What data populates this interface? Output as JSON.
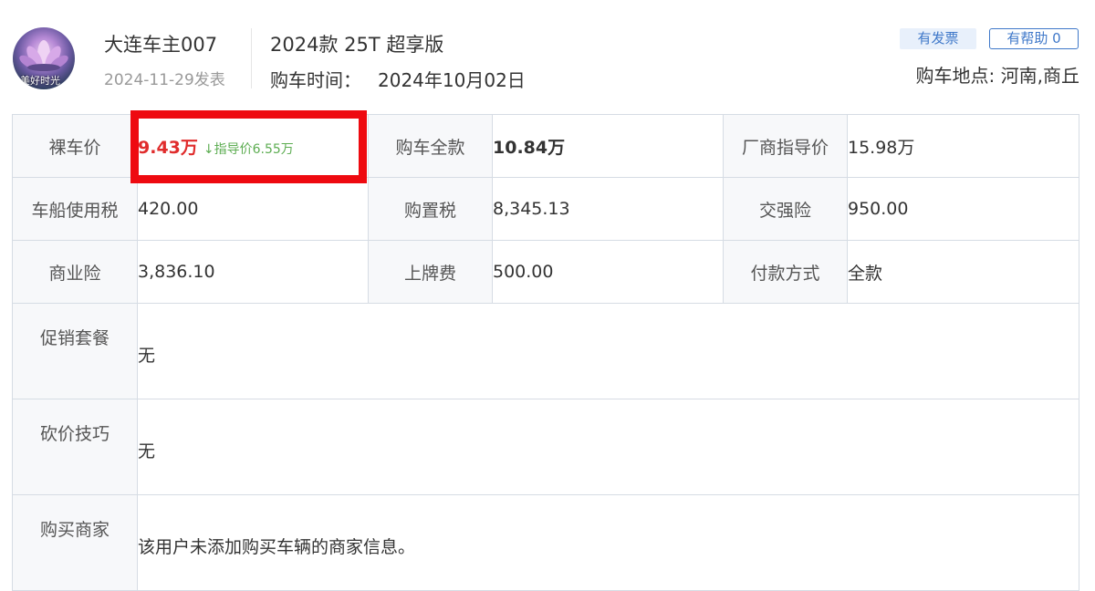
{
  "user": {
    "avatar_icon": "lotus-avatar-icon",
    "avatar_caption": "美好时光",
    "name": "大连车主007",
    "post_date": "2024-11-29发表"
  },
  "car": {
    "model": "2024款 25T 超享版",
    "buy_time_label": "购车时间：",
    "buy_time_value": "2024年10月02日"
  },
  "actions": {
    "invoice_badge": "有发票",
    "helpful_button": "有帮助 0"
  },
  "location": "购车地点: 河南,商丘",
  "table": {
    "bare_price_label": "裸车价",
    "bare_price_value": "9.43万",
    "bare_price_note": "↓指导价6.55万",
    "total_price_label": "购车全款",
    "total_price_value": "10.84万",
    "msrp_label": "厂商指导价",
    "msrp_value": "15.98万",
    "vessel_tax_label": "车船使用税",
    "vessel_tax_value": "420.00",
    "purchase_tax_label": "购置税",
    "purchase_tax_value": "8,345.13",
    "compulsory_ins_label": "交强险",
    "compulsory_ins_value": "950.00",
    "commercial_ins_label": "商业险",
    "commercial_ins_value": "3,836.10",
    "plate_fee_label": "上牌费",
    "plate_fee_value": "500.00",
    "payment_label": "付款方式",
    "payment_value": "全款",
    "promo_label": "促销套餐",
    "promo_value": "无",
    "bargain_label": "砍价技巧",
    "bargain_value": "无",
    "dealer_label": "购买商家",
    "dealer_value": "该用户未添加购买车辆的商家信息。"
  },
  "colors": {
    "accent_blue": "#3f78c9",
    "price_red": "#e02c2c",
    "guide_green": "#5dad52",
    "highlight_red": "#ee0a10"
  }
}
